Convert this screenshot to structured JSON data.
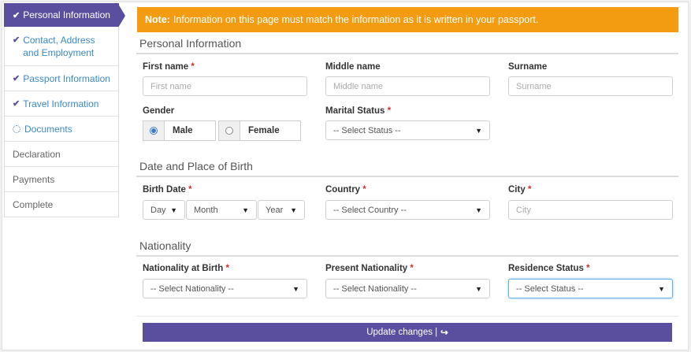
{
  "sidebar": {
    "items": [
      {
        "label": "Personal Information",
        "status": "done",
        "active": true
      },
      {
        "label": "Contact, Address and Employment",
        "status": "done"
      },
      {
        "label": "Passport Information",
        "status": "done"
      },
      {
        "label": "Travel Information",
        "status": "done"
      },
      {
        "label": "Documents",
        "status": "in-progress"
      },
      {
        "label": "Declaration",
        "status": "pending"
      },
      {
        "label": "Payments",
        "status": "pending"
      },
      {
        "label": "Complete",
        "status": "pending"
      }
    ]
  },
  "note": {
    "prefix": "Note:",
    "text": "Information on this page must match the information as it is written in your passport."
  },
  "personal": {
    "title": "Personal Information",
    "first_name_label": "First name",
    "first_name_placeholder": "First name",
    "middle_name_label": "Middle name",
    "middle_name_placeholder": "Middle name",
    "surname_label": "Surname",
    "surname_placeholder": "Surname",
    "gender_label": "Gender",
    "gender_male": "Male",
    "gender_female": "Female",
    "gender_selected": "Male",
    "marital_label": "Marital Status",
    "marital_value": "-- Select Status --"
  },
  "birth": {
    "title": "Date and Place of Birth",
    "date_label": "Birth Date",
    "day": "Day",
    "month": "Month",
    "year": "Year",
    "country_label": "Country",
    "country_value": "-- Select Country --",
    "city_label": "City",
    "city_placeholder": "City"
  },
  "nationality": {
    "title": "Nationality",
    "birth_label": "Nationality at Birth",
    "birth_value": "-- Select Nationality --",
    "present_label": "Present Nationality",
    "present_value": "-- Select Nationality --",
    "residence_label": "Residence Status",
    "residence_value": "-- Select Status --"
  },
  "required_mark": "*",
  "submit_label": "Update changes |",
  "colors": {
    "accent": "#5a4e9e",
    "note": "#f39c12",
    "link": "#3a8ac4",
    "required": "#d9302c"
  }
}
